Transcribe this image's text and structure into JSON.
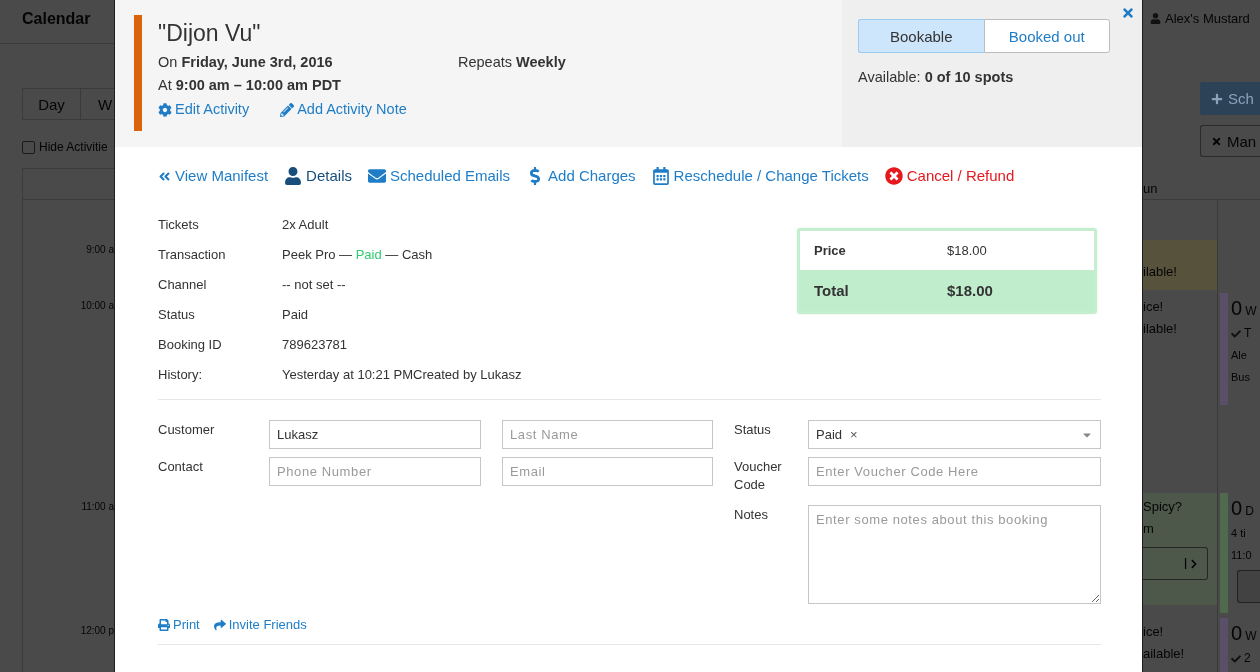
{
  "background": {
    "app_title": "Calendar",
    "user_name": "Alex's Mustard",
    "view_tabs": [
      {
        "label": "Day",
        "selected": false
      },
      {
        "label": "W",
        "selected": false
      }
    ],
    "hide_activities": {
      "label": "Hide Activitie",
      "checked": false
    },
    "toolbar_buttons": [
      {
        "kind": "primary",
        "label": "Sch"
      },
      {
        "kind": "outline",
        "label": "Man"
      }
    ],
    "day_heading": "un",
    "times": [
      "9:00 a",
      "10:00 a",
      "11:00 a",
      "12:00 p"
    ],
    "calendar_slots": [
      {
        "lines": [
          "ilable!"
        ],
        "color": "#57523b"
      },
      {
        "lines": [
          "ice!",
          "ilable!"
        ]
      },
      {
        "lines": [
          "Spicy?",
          "m"
        ],
        "button": "l",
        "color": "#4d584b"
      },
      {
        "lines": [
          "ice!",
          "ailable!"
        ]
      }
    ],
    "calendar_events": [
      {
        "count": "0",
        "title": "W",
        "color": "#5a4f68",
        "lines": [
          {
            "kind": "check",
            "text": "T"
          },
          {
            "kind": "text",
            "text": "Ale"
          },
          {
            "kind": "text",
            "text": "Bus"
          }
        ]
      },
      {
        "count": "0",
        "title": "D",
        "color": "#4f6a4d",
        "lines": [
          {
            "kind": "text",
            "text": "4 ti"
          },
          {
            "kind": "text",
            "text": "11:0"
          },
          {
            "kind": "button"
          }
        ]
      },
      {
        "count": "0",
        "title": "W",
        "color": "#5a4f68",
        "lines": [
          {
            "kind": "check",
            "text": "2"
          }
        ]
      }
    ]
  },
  "modal": {
    "activity": {
      "title": "\"Dijon Vu\"",
      "date": "On **Friday, June 3rd, 2016**",
      "repeats": "Repeats **Weekly**",
      "time": "At **9:00 am – 10:00 am PDT**",
      "links": [
        "Edit Activity",
        "Add Activity Note"
      ]
    },
    "availability_toggle": [
      {
        "label": "Bookable",
        "selected": true
      },
      {
        "label": "Booked out",
        "selected": false
      }
    ],
    "availability": "Available: **0 of 10 spots**",
    "nav": [
      {
        "label": "View Manifest",
        "kind": "link",
        "selected": false
      },
      {
        "label": "Details",
        "kind": "link",
        "selected": true
      },
      {
        "label": "Scheduled Emails",
        "kind": "link",
        "selected": false
      },
      {
        "label": "Add Charges",
        "kind": "link",
        "selected": false
      },
      {
        "label": "Reschedule / Change Tickets",
        "kind": "link",
        "selected": false
      },
      {
        "label": "Cancel / Refund",
        "kind": "danger",
        "selected": false
      }
    ],
    "details": [
      {
        "label": "Tickets",
        "value_parts": [
          {
            "text": "2x Adult"
          }
        ]
      },
      {
        "label": "Transaction",
        "value_parts": [
          {
            "text": "Peek Pro — "
          },
          {
            "text": "Paid",
            "color": "#2ecc71"
          },
          {
            "text": " — Cash"
          }
        ]
      },
      {
        "label": "Channel",
        "value_parts": [
          {
            "text": "-- not set --"
          }
        ]
      },
      {
        "label": "Status",
        "value_parts": [
          {
            "text": "Paid"
          }
        ]
      },
      {
        "label": "Booking ID",
        "value_parts": [
          {
            "text": "789623781"
          }
        ]
      },
      {
        "label": "History:",
        "value_parts": [
          {
            "text": "Yesterday at 10:21 PMCreated by Lukasz"
          }
        ]
      }
    ],
    "price_summary": [
      {
        "kind": "line",
        "label": "Price",
        "value": "$18.00"
      },
      {
        "kind": "total",
        "label": "Total",
        "value": "$18.00"
      }
    ],
    "form": {
      "contact_rows": [
        {
          "label": "Customer",
          "fields": [
            {
              "value": "Lukasz"
            },
            {
              "placeholder": "Last Name"
            }
          ]
        },
        {
          "label": "Contact",
          "fields": [
            {
              "placeholder": "Phone Number"
            },
            {
              "placeholder": "Email"
            }
          ]
        }
      ],
      "booking_rows": [
        {
          "kind": "select",
          "label": "Status",
          "value": "Paid",
          "clear": "×"
        },
        {
          "kind": "input",
          "label": "Voucher Code",
          "placeholder": "Enter Voucher Code Here"
        },
        {
          "kind": "textarea",
          "label": "Notes",
          "placeholder": "Enter some notes about this booking"
        }
      ]
    },
    "footer_links": [
      "Print",
      "Invite Friends"
    ]
  }
}
